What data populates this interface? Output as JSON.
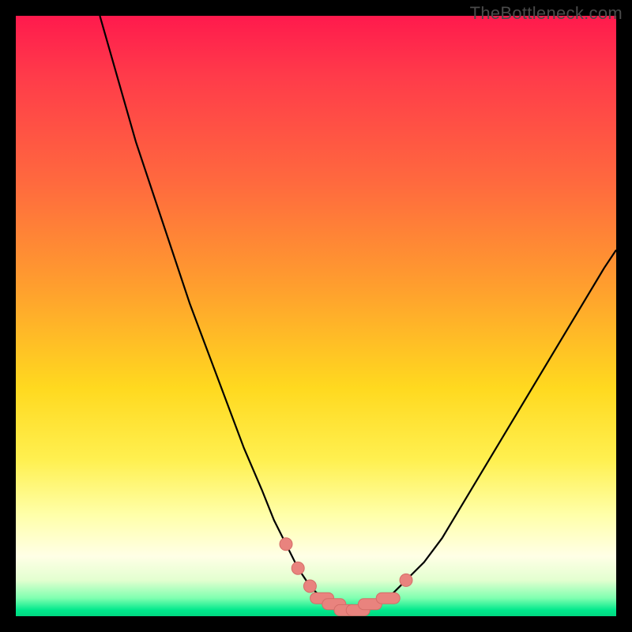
{
  "watermark": "TheBottleneck.com",
  "colors": {
    "curve_stroke": "#000000",
    "marker_fill": "#e9837e",
    "marker_stroke": "#d46d68",
    "frame_background": "#000000"
  },
  "chart_data": {
    "type": "line",
    "title": "",
    "xlabel": "",
    "ylabel": "",
    "xlim": [
      0,
      100
    ],
    "ylim": [
      0,
      100
    ],
    "series": [
      {
        "name": "bottleneck-curve",
        "x": [
          14,
          16,
          18,
          20,
          23,
          26,
          29,
          32,
          35,
          38,
          41,
          43,
          45,
          47,
          49,
          51,
          53,
          55,
          57,
          59,
          62,
          65,
          68,
          71,
          74,
          77,
          80,
          83,
          86,
          89,
          92,
          95,
          98,
          100
        ],
        "y": [
          100,
          93,
          86,
          79,
          70,
          61,
          52,
          44,
          36,
          28,
          21,
          16,
          12,
          8,
          5,
          3,
          2,
          1,
          1,
          2,
          3,
          6,
          9,
          13,
          18,
          23,
          28,
          33,
          38,
          43,
          48,
          53,
          58,
          61
        ]
      }
    ],
    "markers": {
      "name": "highlighted-points",
      "x": [
        45,
        47,
        49,
        51,
        53,
        55,
        57,
        59,
        62,
        65
      ],
      "y": [
        12,
        8,
        5,
        3,
        2,
        1,
        1,
        2,
        3,
        6
      ]
    }
  }
}
